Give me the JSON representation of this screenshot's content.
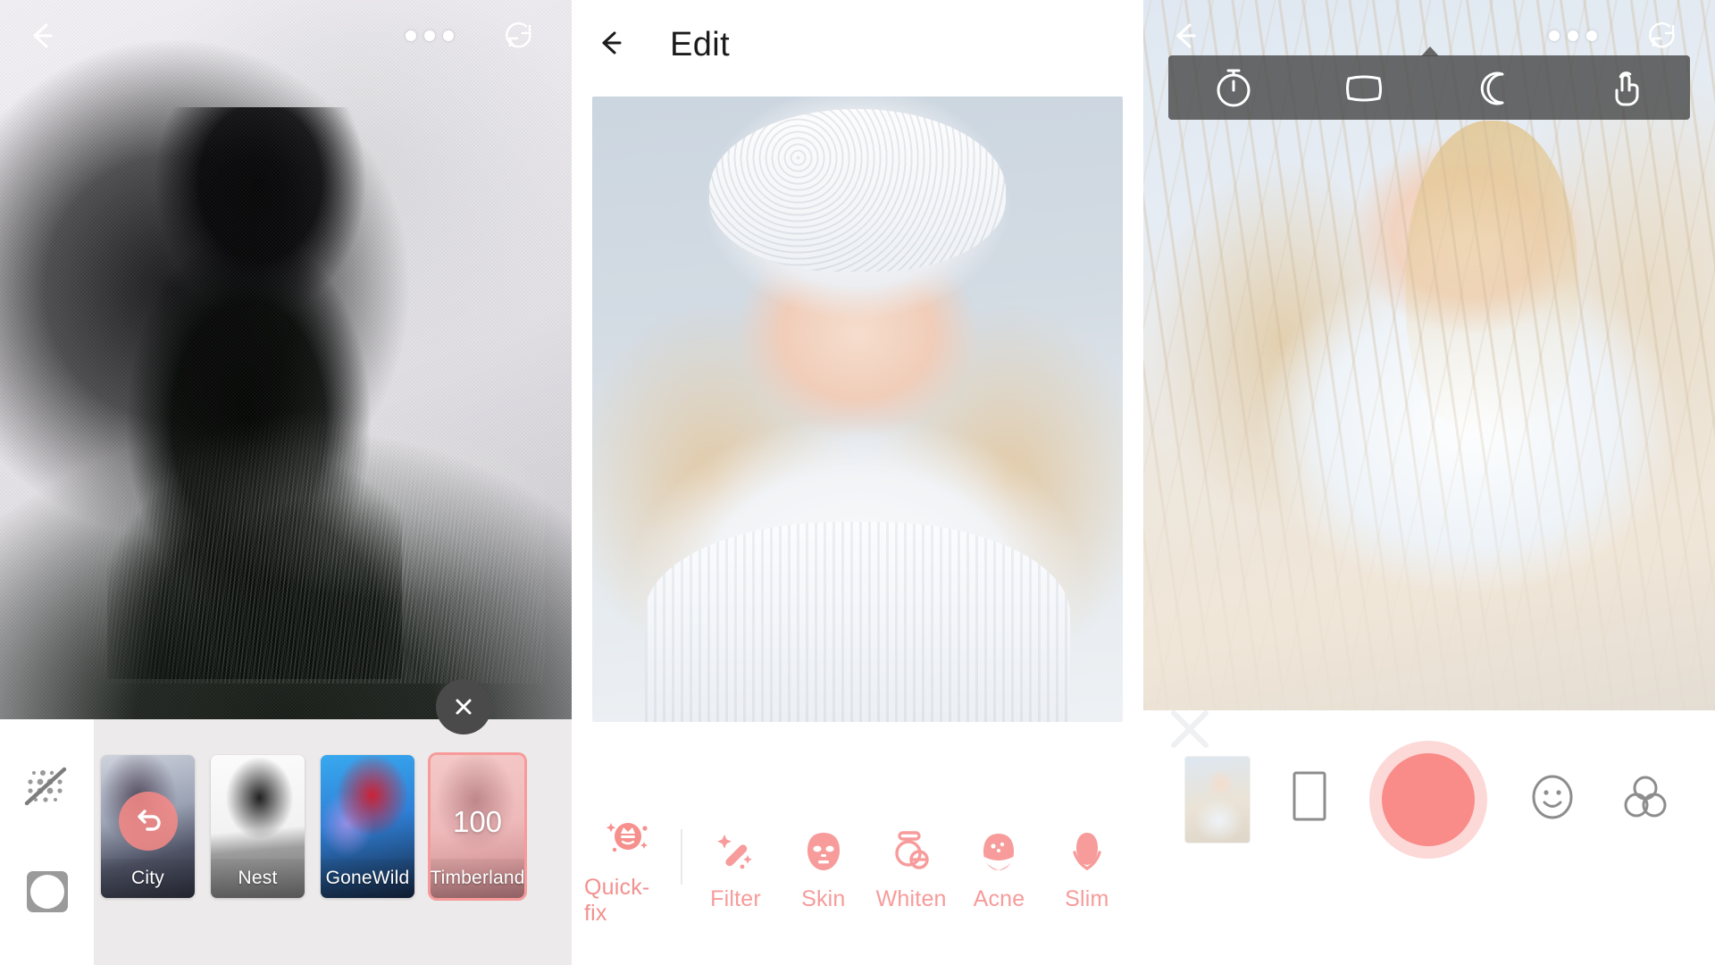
{
  "app": {
    "accent": "#f98b88",
    "accent_soft": "#f79b9b",
    "tray_bg": "#eceaea",
    "menu_bg": "rgba(70,70,70,0.80)"
  },
  "filter_screen": {
    "topbar": {
      "back_icon": "back-arrow-icon",
      "more_icon": "more-options-icon",
      "flip_icon": "flip-rotate-icon"
    },
    "close_label": "close-icon",
    "side_tools": [
      {
        "name": "grid-off-icon",
        "label": "Grid off"
      },
      {
        "name": "shape-mask-icon",
        "label": "Shape mask"
      }
    ],
    "filters": [
      {
        "label": "City",
        "state": "applied",
        "badge": "undo-icon",
        "value": ""
      },
      {
        "label": "Nest",
        "state": "normal",
        "badge": "",
        "value": ""
      },
      {
        "label": "GoneWild",
        "state": "normal",
        "badge": "",
        "value": ""
      },
      {
        "label": "Timberland",
        "state": "adjusting",
        "badge": "value",
        "value": "100"
      }
    ]
  },
  "edit_screen": {
    "header": {
      "back_icon": "back-arrow-icon",
      "title": "Edit"
    },
    "tools": [
      {
        "label": "Quick-fix",
        "icon": "quickfix-crown-face-icon",
        "primary": true
      },
      {
        "label": "Filter",
        "icon": "magic-wand-icon",
        "primary": false
      },
      {
        "label": "Skin",
        "icon": "face-mask-icon",
        "primary": false
      },
      {
        "label": "Whiten",
        "icon": "powder-compact-icon",
        "primary": false
      },
      {
        "label": "Acne",
        "icon": "acne-face-icon",
        "primary": false
      },
      {
        "label": "Slim",
        "icon": "slim-face-icon",
        "primary": false
      }
    ]
  },
  "camera_screen": {
    "topbar": {
      "back_icon": "back-arrow-icon",
      "more_icon": "more-options-icon",
      "flip_icon": "flip-rotate-icon"
    },
    "popup_menu": [
      {
        "icon": "timer-icon",
        "label": "Timer"
      },
      {
        "icon": "aspect-ratio-icon",
        "label": "Aspect ratio"
      },
      {
        "icon": "night-mode-icon",
        "label": "Night mode"
      },
      {
        "icon": "touch-shoot-icon",
        "label": "Touch shoot"
      }
    ],
    "ghost_icon": "close-watermark-icon",
    "controls": [
      {
        "icon": "gallery-thumbnail",
        "label": "Gallery"
      },
      {
        "icon": "frame-icon",
        "label": "Frame"
      },
      {
        "icon": "shutter-button",
        "label": "Shutter"
      },
      {
        "icon": "sticker-smiley-icon",
        "label": "Stickers"
      },
      {
        "icon": "filters-circles-icon",
        "label": "Filters"
      }
    ]
  }
}
